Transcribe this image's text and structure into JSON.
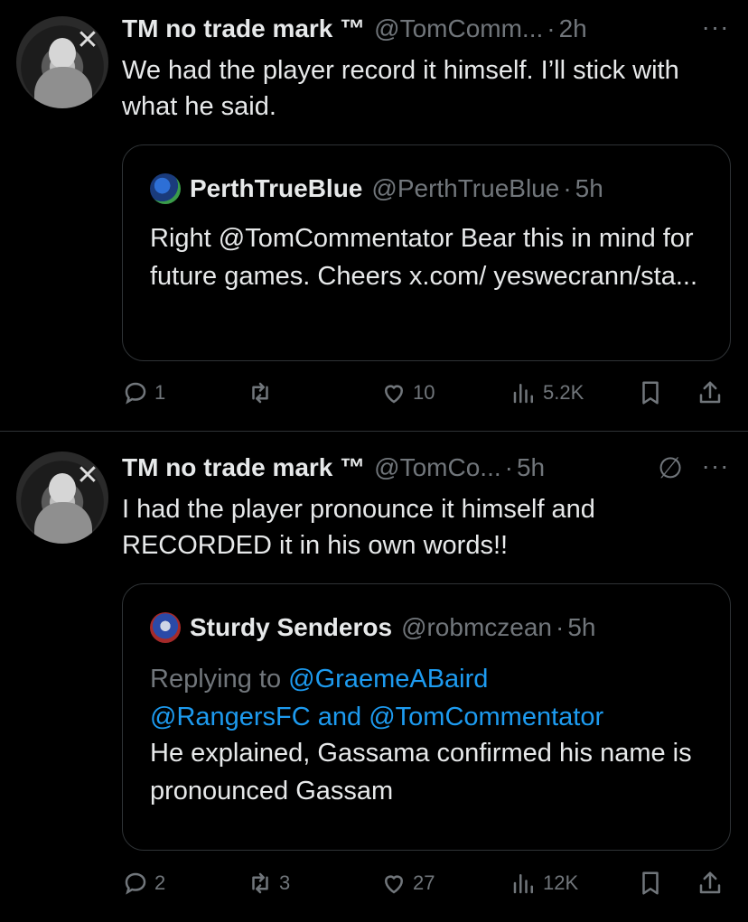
{
  "tweets": [
    {
      "name": "TM no trade mark ™",
      "handle": "@TomComm...",
      "dot": "·",
      "time": "2h",
      "more": "···",
      "text": "We had the player record it himself.  I’ll stick with what he said.",
      "quote": {
        "name": "PerthTrueBlue",
        "handle": "@PerthTrueBlue",
        "dot": "·",
        "time": "5h",
        "text": "Right @TomCommentator Bear this in mind for future games. Cheers x.com/ yeswecrann/sta..."
      },
      "actions": {
        "replies": "1",
        "reposts": "",
        "likes": "10",
        "views": "5.2K"
      }
    },
    {
      "name": "TM no trade mark ™",
      "handle": "@TomCo...",
      "dot": "·",
      "time": "5h",
      "more": "···",
      "text": "I had the player pronounce it himself and RECORDED it in his own words!!",
      "quote": {
        "name": "Sturdy Senderos",
        "handle": "@robmczean",
        "dot": "·",
        "time": "5h",
        "replying_prefix": "Replying to ",
        "replying_to_1": "@GraemeABaird",
        "replying_to_2": "@RangersFC",
        "replying_and": " and ",
        "replying_to_3": "@TomCommentator",
        "text": "He explained, Gassama confirmed his name is pronounced Gassam"
      },
      "actions": {
        "replies": "2",
        "reposts": "3",
        "likes": "27",
        "views": "12K"
      }
    }
  ],
  "colors": {
    "background": "#000000",
    "text": "#e7e9ea",
    "muted": "#71767b",
    "link": "#1d9bf0",
    "border": "#2f3336"
  },
  "icons": [
    "reply-icon",
    "repost-icon",
    "like-icon",
    "views-icon",
    "bookmark-icon",
    "share-icon",
    "more-icon",
    "grok-icon"
  ]
}
